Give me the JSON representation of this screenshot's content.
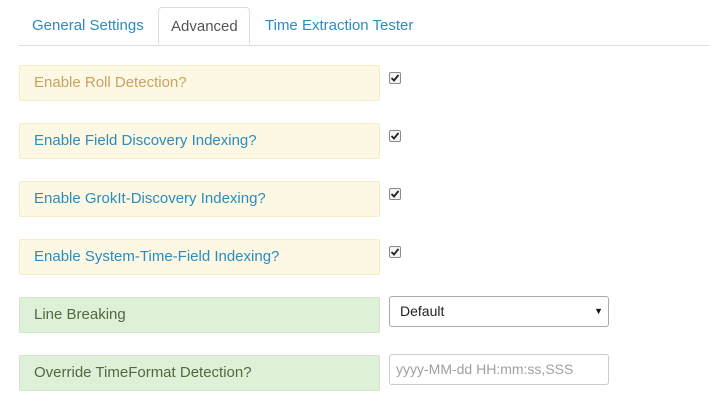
{
  "tabs": [
    {
      "label": "General Settings",
      "active": false
    },
    {
      "label": "Advanced",
      "active": true
    },
    {
      "label": "Time Extraction Tester",
      "active": false
    }
  ],
  "options": [
    {
      "label": "Enable Roll Detection?",
      "checked": true,
      "label_color": "#c9a264"
    },
    {
      "label": "Enable Field Discovery Indexing?",
      "checked": true,
      "label_color": "#2a8cbf"
    },
    {
      "label": "Enable GrokIt-Discovery Indexing?",
      "checked": true,
      "label_color": "#2a8cbf"
    },
    {
      "label": "Enable System-Time-Field Indexing?",
      "checked": true,
      "label_color": "#2a8cbf"
    }
  ],
  "line_breaking": {
    "label": "Line Breaking",
    "selected": "Default"
  },
  "timeformat": {
    "label": "Override TimeFormat Detection?",
    "placeholder": "yyyy-MM-dd HH:mm:ss,SSS",
    "value": ""
  },
  "colors": {
    "tab_link": "#2a8cbf",
    "warning_bg": "#fcf8e3",
    "success_bg": "#dff0d8"
  }
}
